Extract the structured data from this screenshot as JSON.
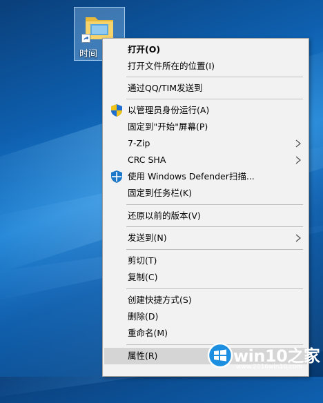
{
  "desktop": {
    "icon_label": "时间"
  },
  "menu": {
    "items": [
      {
        "label": "打开(O)"
      },
      {
        "label": "打开文件所在的位置(I)"
      },
      {
        "label": "通过QQ/TIM发送到"
      },
      {
        "label": "以管理员身份运行(A)"
      },
      {
        "label": "固定到\"开始\"屏幕(P)"
      },
      {
        "label": "7-Zip"
      },
      {
        "label": "CRC SHA"
      },
      {
        "label": "使用 Windows Defender扫描..."
      },
      {
        "label": "固定到任务栏(K)"
      },
      {
        "label": "还原以前的版本(V)"
      },
      {
        "label": "发送到(N)"
      },
      {
        "label": "剪切(T)"
      },
      {
        "label": "复制(C)"
      },
      {
        "label": "创建快捷方式(S)"
      },
      {
        "label": "删除(D)"
      },
      {
        "label": "重命名(M)"
      },
      {
        "label": "属性(R)"
      }
    ]
  },
  "watermark": {
    "title": "win10之家",
    "url": "www.2016win10.com"
  },
  "colors": {
    "menu_bg": "#f2f2f2",
    "hover_bg": "#d5d5d5",
    "separator": "#bdbdbd",
    "shield_blue": "#1f6fd0",
    "shield_yellow": "#f2c319",
    "defender_blue": "#1e78c8"
  },
  "icons": [
    "folder-icon",
    "shortcut-arrow-icon",
    "uac-shield-icon",
    "windows-defender-icon",
    "chevron-right-icon",
    "win10-logo-icon"
  ]
}
